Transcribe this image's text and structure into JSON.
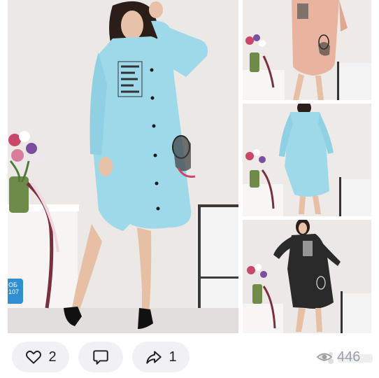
{
  "listing": {
    "badge_line1": "ОБ",
    "badge_line2": "107",
    "thumb_count": 3
  },
  "actions": {
    "like_count": "2",
    "share_count": "1",
    "views_count": "446"
  },
  "icons": {
    "like": "heart-icon",
    "comment": "comment-icon",
    "share": "share-arrow-icon",
    "views": "eye-icon"
  },
  "colors": {
    "dress_blue": "#9ed9ea",
    "dress_peach": "#e8b39f",
    "dress_black": "#2a2a2a",
    "pill_bg": "#f1f1f3",
    "badge_blue": "#2f8fd0"
  }
}
